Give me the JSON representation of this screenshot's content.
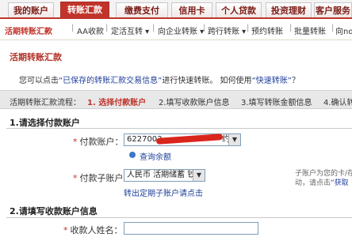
{
  "tabs": [
    {
      "label": "我的账户",
      "active": false
    },
    {
      "label": "转账汇款",
      "active": true
    },
    {
      "label": "缴费支付",
      "active": false
    },
    {
      "label": "信用卡",
      "active": false
    },
    {
      "label": "个人贷款",
      "active": false
    },
    {
      "label": "投资理财",
      "active": false
    },
    {
      "label": "客户服务",
      "active": false
    }
  ],
  "subnav": [
    {
      "label": "活期转账汇款",
      "active": true
    },
    {
      "label": "AA收款",
      "active": false
    },
    {
      "label": "定活互转 ▾",
      "active": false
    },
    {
      "label": "向企业转账 ▾",
      "active": false
    },
    {
      "label": "跨行转账 ▾",
      "active": false
    },
    {
      "label": "预约转账",
      "active": false
    },
    {
      "label": "批量转账",
      "active": false
    },
    {
      "label": "向nd",
      "active": false
    }
  ],
  "page": {
    "title": "活期转账汇款",
    "intro_prefix": "您可以点击",
    "intro_link1": "“已保存的转账汇款交易信息”",
    "intro_mid": "进行快速转账。  如何使用",
    "intro_link2": "“快速转账”",
    "intro_suffix": "？"
  },
  "steps": {
    "prefix": "活期转账汇款流程：",
    "items": [
      {
        "label": "1. 选择付款账户",
        "active": true
      },
      {
        "label": "2.填写收款账户信息",
        "active": false
      },
      {
        "label": "3.填写转账金额信息",
        "active": false
      },
      {
        "label": "4.确认转",
        "active": false
      }
    ]
  },
  "section1": {
    "title": "1.请选择付款账户",
    "pay_account_label": "付款账户：",
    "pay_account_value": "6227003",
    "pay_account_suffix": "约",
    "balance_link": "查询余额",
    "sub_account_label": "付款子账户：",
    "sub_account_value": "人民币 活期储蓄 钞",
    "fixed_link": "转出定期子账户请点击",
    "hint_line1": "子账户为您的卡/存",
    "hint_line2_prefix": "动，请点击",
    "hint_line2_link": "“获取"
  },
  "section2": {
    "title": "2.请填写收款账户信息",
    "payee_name_label": "收款人姓名：",
    "payee_name_value": ""
  },
  "colors": {
    "brand": "#c0342b",
    "link": "#1f3f9b"
  }
}
